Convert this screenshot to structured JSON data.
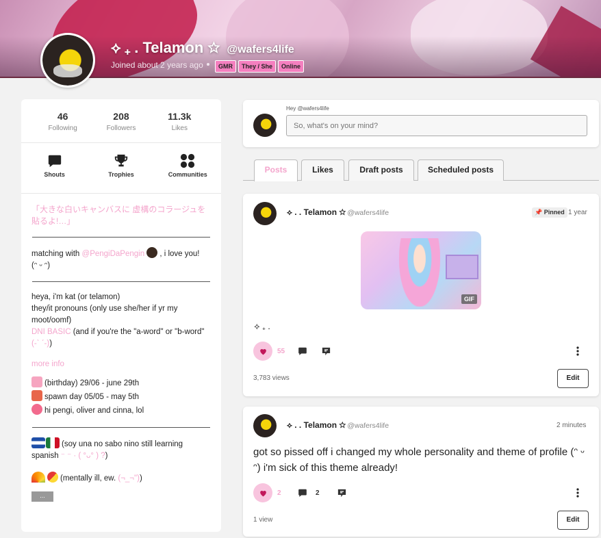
{
  "profile": {
    "name": "⟡ ₊ . Telamon ☆",
    "handle": "@wafers4life",
    "joined": "Joined about 2 years ago",
    "badges": [
      "GMR",
      "They / She",
      "Online"
    ]
  },
  "stats": [
    {
      "value": "46",
      "label": "Following"
    },
    {
      "value": "208",
      "label": "Followers"
    },
    {
      "value": "11.3k",
      "label": "Likes"
    }
  ],
  "shortcuts": [
    {
      "label": "Shouts",
      "icon": "chat-bubble-icon"
    },
    {
      "label": "Trophies",
      "icon": "trophy-icon"
    },
    {
      "label": "Communities",
      "icon": "grid-dots-icon"
    }
  ],
  "bio": {
    "quote": "「大きな白いキャンバスに 虚構のコラージュを貼るよ!…」",
    "matching_prefix": "matching with ",
    "matching_link": "@PengiDaPengin",
    "matching_suffix": ", i love you!",
    "matching_face": "(ᵔ ᵕ ᵔ)",
    "intro_1": "heya, i'm kat (or telamon)",
    "intro_2": "they/it pronouns (only use she/her if yr my moot/oomf)",
    "dni_link": "DNI BASIC",
    "dni_text": " (and if you're the \"a-word\" or \"b-word\" ",
    "dni_face": "(-ˋ ˊ-)",
    "dni_close": ")",
    "more_info": "more info",
    "birthday": "(birthday) 29/06 - june 29th",
    "spawn": "spawn day 05/05 - may 5th",
    "hi": "hi pengi, oliver and cinna, lol",
    "spanish": "(soy una no sabo nino still learning spanish ",
    "spanish_face": "⁻ ⁻ · ( °ᴗ° ) ?",
    "spanish_close": ")",
    "mental": "(mentally ill, ew. ",
    "mental_face": "(¬_¬\")",
    "mental_close": ")",
    "more_button": "..."
  },
  "composer": {
    "hey": "Hey @wafers4life",
    "placeholder": "So, what's on your mind?"
  },
  "tabs": [
    "Posts",
    "Likes",
    "Draft posts",
    "Scheduled posts"
  ],
  "posts": [
    {
      "name": "⟡ . . Telamon ☆",
      "handle": "@wafers4life",
      "pinned": "Pinned",
      "time": "1 year",
      "gif_label": "GIF",
      "caption": "⟡ ₊ .",
      "likes": "55",
      "views": "3,783 views",
      "edit": "Edit"
    },
    {
      "name": "⟡ . . Telamon ☆",
      "handle": "@wafers4life",
      "time": "2 minutes",
      "text": "got so pissed off i changed my whole personality and theme of profile (ᵔ ᵕ ᵔ) i'm sick of this theme already!",
      "likes": "2",
      "comments": "2",
      "views": "1 view",
      "edit": "Edit"
    }
  ],
  "colors": {
    "accent_pink": "#f4a5cc",
    "badge_pink": "#f47fbf",
    "like_bg": "#f8c4de",
    "heart": "#c2185b"
  }
}
